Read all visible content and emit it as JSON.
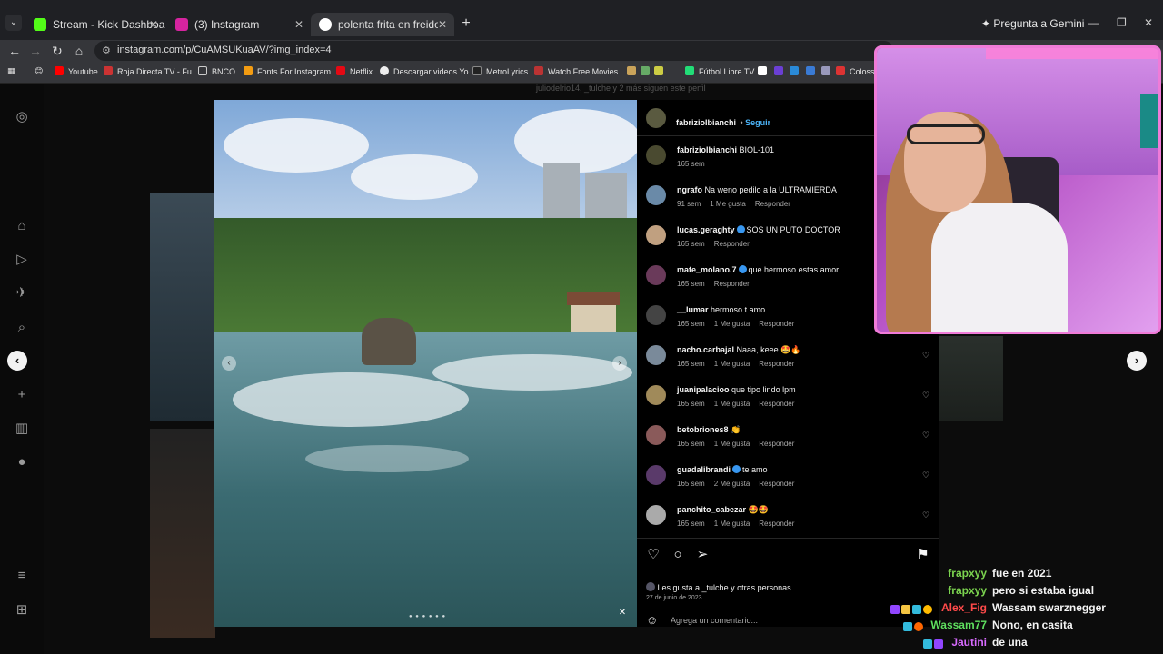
{
  "browser": {
    "tabs": [
      {
        "label": "Stream - Kick Dashboard",
        "color": "#53fc18"
      },
      {
        "label": "(3) Instagram",
        "color": "#d6249f"
      },
      {
        "label": "polenta frita en freidora de aire",
        "color": "#4285f4"
      }
    ],
    "gemini_label": "Pregunta a Gemini",
    "url": "instagram.com/p/CuAMSUKuaAV/?img_index=4",
    "bookmarks": [
      "Youtube",
      "Roja Directa TV - Fu...",
      "BNCO",
      "Fonts For Instagram...",
      "Netflix",
      "Descargar videos Yo...",
      "MetroLyrics",
      "Watch Free Movies...",
      "Fútbol Libre TV",
      "Colossal"
    ]
  },
  "instagram": {
    "behind_text": "juliodelrio14, _tulche y 2 más siguen este perfil",
    "post": {
      "author": "fabriziolbianchi",
      "follow_label": "Seguir",
      "comments": [
        {
          "user": "fabriziolbianchi",
          "text": "BIOL-101",
          "time": "165 sem",
          "likes": "",
          "reply": "",
          "verified": false,
          "heart": false
        },
        {
          "user": "ngrafo",
          "text": "Na weno pedilo a la ULTRAMIERDA",
          "time": "91 sem",
          "likes": "1 Me gusta",
          "reply": "Responder",
          "verified": false,
          "heart": false
        },
        {
          "user": "lucas.geraghty",
          "text": "SOS UN PUTO DOCTOR",
          "time": "165 sem",
          "likes": "",
          "reply": "Responder",
          "verified": true,
          "heart": false
        },
        {
          "user": "mate_molano.7",
          "text": "que hermoso estas amor",
          "time": "165 sem",
          "likes": "",
          "reply": "Responder",
          "verified": true,
          "heart": false
        },
        {
          "user": "__lumar",
          "text": "hermoso t amo",
          "time": "165 sem",
          "likes": "1 Me gusta",
          "reply": "Responder",
          "verified": false,
          "heart": false
        },
        {
          "user": "nacho.carbajal",
          "text": "Naaa, keee 🤩🔥",
          "time": "165 sem",
          "likes": "1 Me gusta",
          "reply": "Responder",
          "verified": false,
          "heart": true
        },
        {
          "user": "juanipalacioo",
          "text": "que tipo lindo lpm",
          "time": "165 sem",
          "likes": "1 Me gusta",
          "reply": "Responder",
          "verified": false,
          "heart": true
        },
        {
          "user": "betobriones8",
          "text": "👏",
          "time": "165 sem",
          "likes": "1 Me gusta",
          "reply": "Responder",
          "verified": false,
          "heart": true
        },
        {
          "user": "guadalibrandi",
          "text": "te amo",
          "time": "165 sem",
          "likes": "2 Me gusta",
          "reply": "Responder",
          "verified": true,
          "heart": true
        },
        {
          "user": "panchito_cabezar",
          "text": "🤩🤩",
          "time": "165 sem",
          "likes": "1 Me gusta",
          "reply": "Responder",
          "verified": false,
          "heart": true
        }
      ],
      "likes_text": "Les gusta a _tulche y otras personas",
      "date": "27 de junio de 2023",
      "comment_placeholder": "Agrega un comentario..."
    }
  },
  "chat": [
    {
      "user": "frapxyy",
      "color": "#7bd34f",
      "msg": "fue en 2021"
    },
    {
      "user": "frapxyy",
      "color": "#7bd34f",
      "msg": "pero si estaba igual"
    },
    {
      "user": "Alex_Fig",
      "color": "#ff4a4a",
      "msg": "Wassam swarznegger"
    },
    {
      "user": "Wassam77",
      "color": "#5fe05f",
      "msg": "Nono, en casita"
    },
    {
      "user": "Jautini",
      "color": "#d86bff",
      "msg": "de una"
    }
  ]
}
